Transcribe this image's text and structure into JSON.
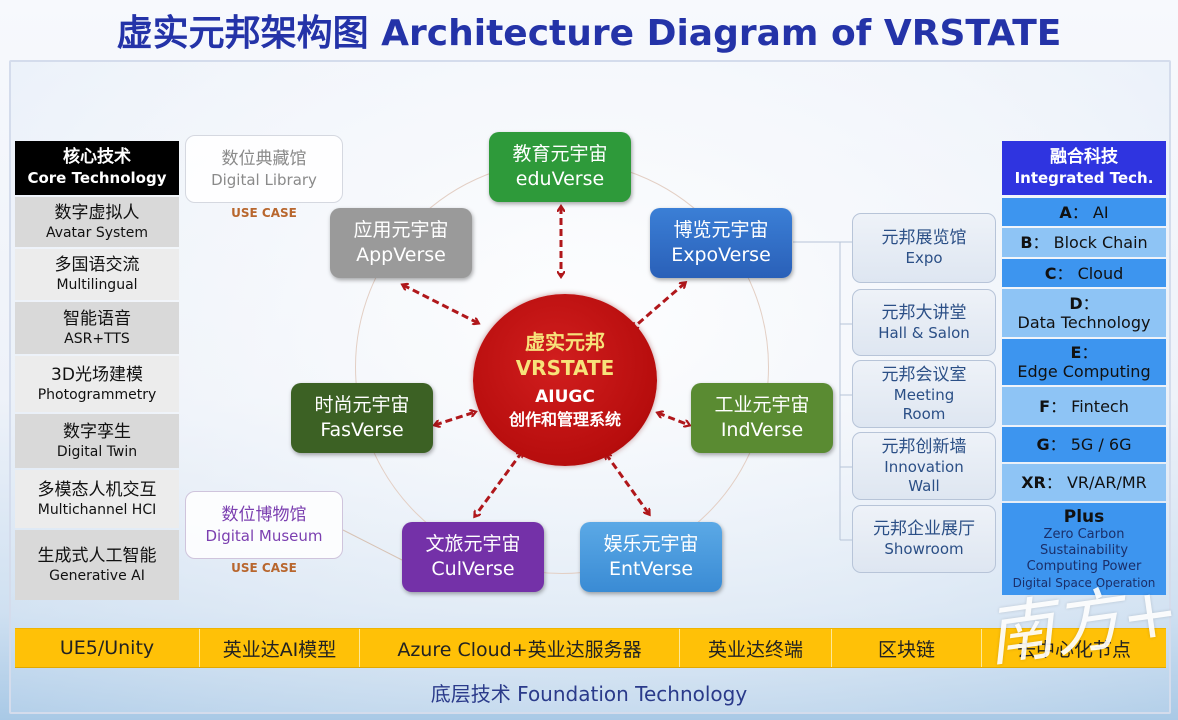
{
  "title": "虚实元邦架构图 Architecture Diagram of VRSTATE",
  "core_technology": {
    "header_zh": "核心技术",
    "header_en": "Core Technology",
    "items": [
      {
        "zh": "数字虚拟人",
        "en": "Avatar System"
      },
      {
        "zh": "多国语交流",
        "en": "Multilingual"
      },
      {
        "zh": "智能语音",
        "en": "ASR+TTS"
      },
      {
        "zh": "3D光场建模",
        "en": "Photogrammetry"
      },
      {
        "zh": "数字孪生",
        "en": "Digital Twin"
      },
      {
        "zh": "多模态人机交互",
        "en": "Multichannel HCI"
      },
      {
        "zh": "生成式人工智能",
        "en": "Generative AI"
      }
    ]
  },
  "use_cases": [
    {
      "zh": "数位典藏馆",
      "en": "Digital Library",
      "label": "USE CASE",
      "color": "#8a8a8a"
    },
    {
      "zh": "数位博物馆",
      "en": "Digital Museum",
      "label": "USE CASE",
      "color": "#7b3fb0"
    }
  ],
  "hub": {
    "line1": "虚实元邦",
    "line2": "VRSTATE",
    "line3": "AIUGC",
    "line4": "创作和管理系统",
    "color": "#c41414"
  },
  "verses": [
    {
      "id": "edu",
      "zh": "教育元宇宙",
      "en": "eduVerse",
      "color": "#2e9a3a"
    },
    {
      "id": "expo",
      "zh": "博览元宇宙",
      "en": "ExpoVerse",
      "color": "#2f6fc7"
    },
    {
      "id": "app",
      "zh": "应用元宇宙",
      "en": "AppVerse",
      "color": "#9a9a9a"
    },
    {
      "id": "fas",
      "zh": "时尚元宇宙",
      "en": "FasVerse",
      "color": "#3c6124"
    },
    {
      "id": "ind",
      "zh": "工业元宇宙",
      "en": "IndVerse",
      "color": "#5a8b32"
    },
    {
      "id": "cul",
      "zh": "文旅元宇宙",
      "en": "CulVerse",
      "color": "#7431a8"
    },
    {
      "id": "ent",
      "zh": "娱乐元宇宙",
      "en": "EntVerse",
      "color": "#4a9ade"
    }
  ],
  "venues": [
    {
      "zh": "元邦展览馆",
      "en": "Expo"
    },
    {
      "zh": "元邦大讲堂",
      "en": "Hall & Salon"
    },
    {
      "zh": "元邦会议室",
      "en": "Meeting Room"
    },
    {
      "zh": "元邦创新墙",
      "en": "Innovation Wall"
    },
    {
      "zh": "元邦企业展厅",
      "en": "Showroom"
    }
  ],
  "integrated_tech": {
    "header_zh": "融合科技",
    "header_en": "Integrated Tech.",
    "items": [
      {
        "key": "A",
        "value": "AI"
      },
      {
        "key": "B",
        "value": "Block Chain"
      },
      {
        "key": "C",
        "value": "Cloud"
      },
      {
        "key": "D",
        "value": "Data Technology"
      },
      {
        "key": "E",
        "value": "Edge Computing"
      },
      {
        "key": "F",
        "value": "Fintech"
      },
      {
        "key": "G",
        "value": "5G / 6G"
      },
      {
        "key": "XR",
        "value": "VR/AR/MR"
      }
    ],
    "plus": {
      "title": "Plus",
      "lines": [
        "Zero Carbon",
        "Sustainability",
        "Computing Power",
        "Digital Space Operation"
      ]
    }
  },
  "foundation": {
    "cells": [
      "UE5/Unity",
      "英业达AI模型",
      "Azure Cloud+英业达服务器",
      "英业达终端",
      "区块链",
      "去中心化节点"
    ],
    "label": "底层技术 Foundation Technology"
  },
  "watermark": "南方+"
}
